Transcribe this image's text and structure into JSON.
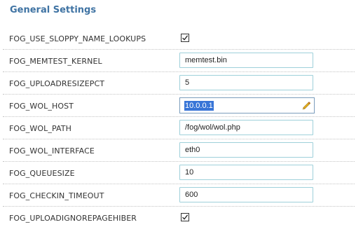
{
  "section": {
    "title": "General Settings"
  },
  "settings": [
    {
      "label": "FOG_USE_SLOPPY_NAME_LOOKUPS",
      "type": "checkbox",
      "checked": true
    },
    {
      "label": "FOG_MEMTEST_KERNEL",
      "type": "text",
      "value": "memtest.bin"
    },
    {
      "label": "FOG_UPLOADRESIZEPCT",
      "type": "text",
      "value": "5"
    },
    {
      "label": "FOG_WOL_HOST",
      "type": "text",
      "value": "10.0.0.1",
      "selected": true,
      "icon": "pencil-icon"
    },
    {
      "label": "FOG_WOL_PATH",
      "type": "text",
      "value": "/fog/wol/wol.php"
    },
    {
      "label": "FOG_WOL_INTERFACE",
      "type": "text",
      "value": "eth0"
    },
    {
      "label": "FOG_QUEUESIZE",
      "type": "text",
      "value": "10"
    },
    {
      "label": "FOG_CHECKIN_TIMEOUT",
      "type": "text",
      "value": "600"
    },
    {
      "label": "FOG_UPLOADIGNOREPAGEHIBER",
      "type": "checkbox",
      "checked": true
    }
  ],
  "colors": {
    "title": "#3f73a3",
    "input_border": "#9ed0da",
    "focused_border": "#7a9cbc",
    "selection": "#3875d7",
    "pencil": "#e8b321"
  }
}
